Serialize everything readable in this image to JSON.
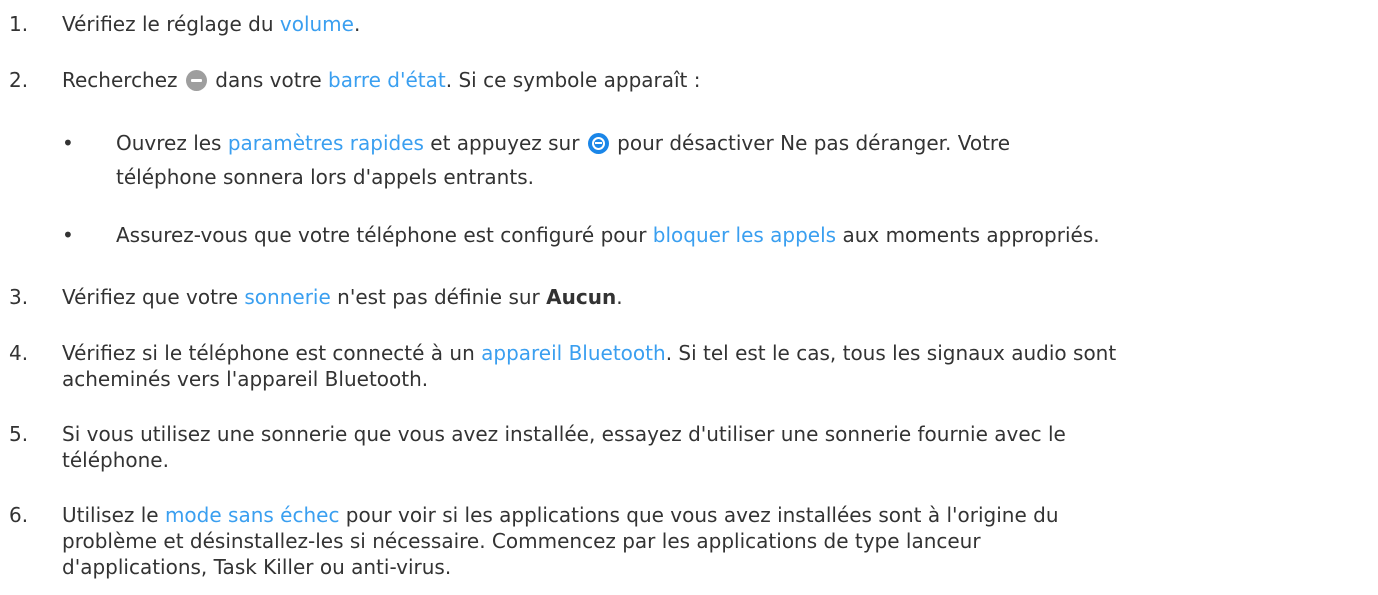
{
  "steps": [
    {
      "number": "1.",
      "pre": "Vérifiez le réglage du ",
      "link": "volume",
      "post": "."
    },
    {
      "number": "2.",
      "pre": "Recherchez ",
      "mid": " dans votre ",
      "link": "barre d'état",
      "post": ". Si ce symbole apparaît :",
      "icon": "do-not-disturb-status-icon",
      "bullets": [
        {
          "pre": "Ouvrez les ",
          "link": "paramètres rapides",
          "mid": " et appuyez sur ",
          "icon": "do-not-disturb-quick-setting-icon",
          "post": " pour désactiver Ne pas déranger. Votre",
          "line2": "téléphone sonnera lors d'appels entrants."
        },
        {
          "pre": "Assurez-vous que votre téléphone est configuré pour ",
          "link": "bloquer les appels",
          "post": " aux moments appropriés."
        }
      ]
    },
    {
      "number": "3.",
      "pre": "Vérifiez que votre ",
      "link": "sonnerie",
      "mid": " n'est pas définie sur ",
      "bold": "Aucun",
      "post": "."
    },
    {
      "number": "4.",
      "pre": "Vérifiez si le téléphone est connecté à un ",
      "link": "appareil Bluetooth",
      "post": ". Si tel est le cas, tous les signaux audio sont",
      "line2": "acheminés vers l'appareil Bluetooth."
    },
    {
      "number": "5.",
      "line1": "Si vous utilisez une sonnerie que vous avez installée, essayez d'utiliser une sonnerie fournie avec le",
      "line2": "téléphone."
    },
    {
      "number": "6.",
      "pre": "Utilisez le ",
      "link": "mode sans échec",
      "post": " pour voir si les applications que vous avez installées sont à l'origine du",
      "line2": "problème et désinstallez-les si nécessaire. Commencez par les applications de type lanceur",
      "line3": "d'applications, Task Killer ou anti-virus."
    }
  ],
  "bullet_char": "•",
  "colors": {
    "text": "#333333",
    "link": "#3a9ff0",
    "dnd_gray": "#9e9e9e",
    "dnd_blue": "#1a86e8"
  }
}
